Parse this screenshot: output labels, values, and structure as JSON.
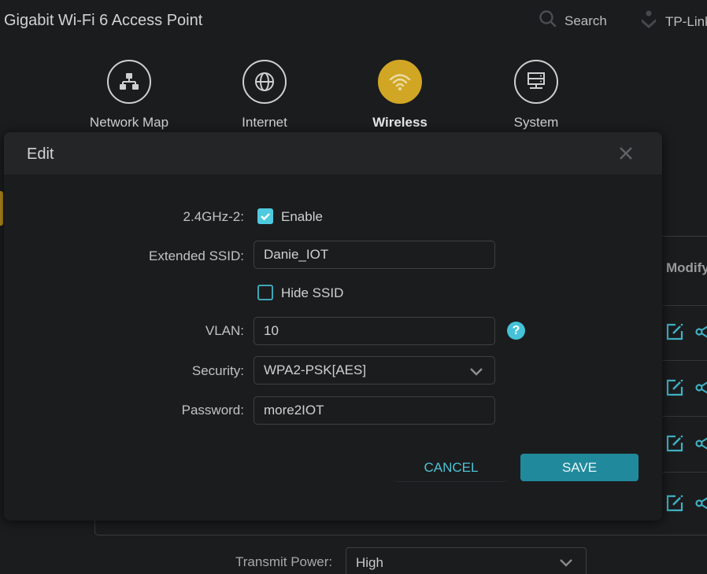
{
  "header": {
    "app_title": "Gigabit Wi-Fi 6 Access Point",
    "search_label": "Search",
    "brand_label": "TP-Link"
  },
  "nav": {
    "items": [
      {
        "label": "Network Map",
        "icon": "network-map-icon",
        "active": false
      },
      {
        "label": "Internet",
        "icon": "globe-icon",
        "active": false
      },
      {
        "label": "Wireless",
        "icon": "wifi-icon",
        "active": true
      },
      {
        "label": "System",
        "icon": "server-icon",
        "active": false
      }
    ],
    "active_color": "#d1a624"
  },
  "background": {
    "table_column_header": "Modify",
    "row_actions": [
      "edit-icon",
      "share-icon"
    ],
    "row_count_visible": 4,
    "transmit_power": {
      "label": "Transmit Power:",
      "value": "High"
    }
  },
  "modal": {
    "title": "Edit",
    "close_icon": "close-icon",
    "band": {
      "label": "2.4GHz-2:",
      "enable_label": "Enable",
      "enabled": true
    },
    "ssid": {
      "label": "Extended SSID:",
      "value": "Danie_IOT"
    },
    "hide_ssid": {
      "label": "Hide SSID",
      "checked": false
    },
    "vlan": {
      "label": "VLAN:",
      "value": "10",
      "help_glyph": "?"
    },
    "security": {
      "label": "Security:",
      "value": "WPA2-PSK[AES]"
    },
    "password": {
      "label": "Password:",
      "value": "more2IOT"
    },
    "buttons": {
      "cancel": "CANCEL",
      "save": "SAVE"
    },
    "accent_color": "#4ecadf",
    "save_color": "#208a9c"
  }
}
